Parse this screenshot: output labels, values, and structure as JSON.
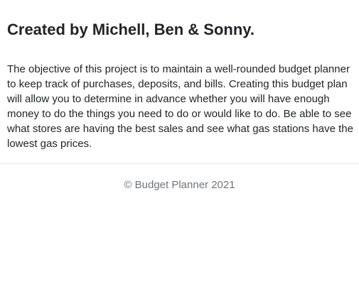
{
  "main": {
    "heading": "Created by Michell, Ben & Sonny.",
    "description": "The objective of this project is to maintain a well-rounded budget planner to keep track of purchases, deposits, and bills. Creating this budget plan will allow you to determine in advance whether you will have enough money to do the things you need to do or would like to do. Be able to see what stores are having the best sales and see what gas stations have the lowest gas prices."
  },
  "footer": {
    "text": "© Budget Planner 2021"
  },
  "colors": {
    "text": "#212529",
    "muted": "#6c757d",
    "divider": "#e5e5e5",
    "background": "#ffffff"
  }
}
